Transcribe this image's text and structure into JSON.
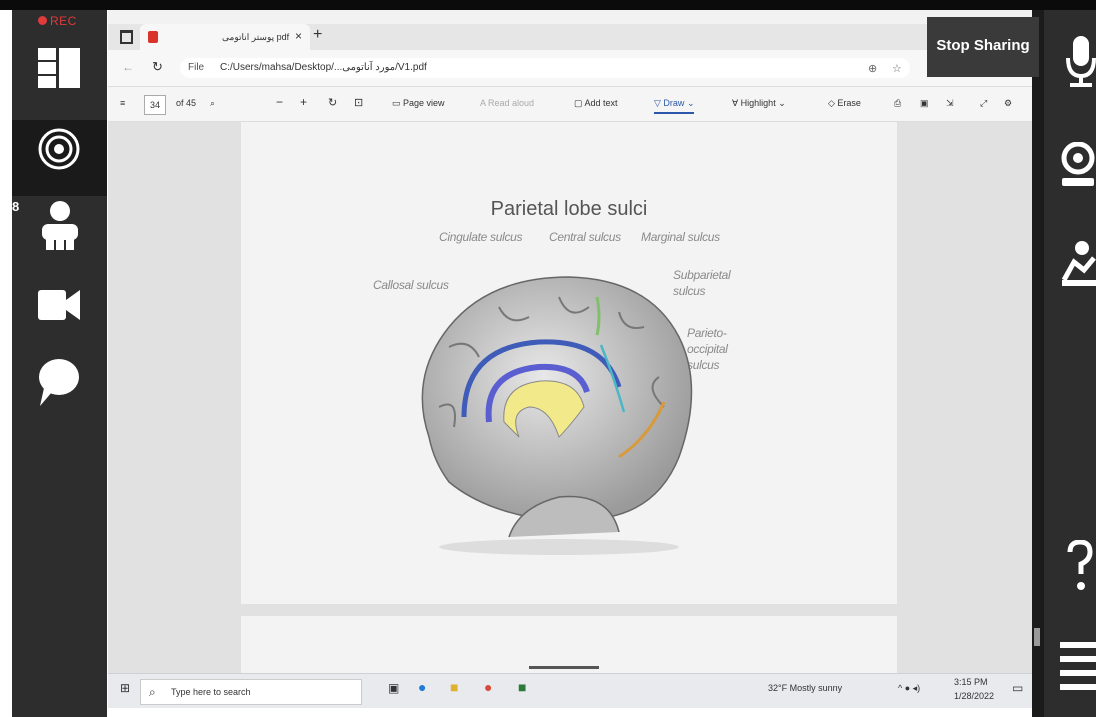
{
  "recorder": {
    "rec_label": "REC",
    "participant_count": "8"
  },
  "share": {
    "stop_label": "Stop Sharing"
  },
  "browser": {
    "tab_title": "پوستر اناتومی pdf",
    "tab_close": "×",
    "new_tab": "+",
    "file_label": "File",
    "url": "C:/Users/mahsa/Desktop/...مورد آناتومی/V1.pdf"
  },
  "pdf_toolbar": {
    "page_number": "34",
    "page_total": "of 45",
    "page_view": "Page view",
    "read_aloud": "Read aloud",
    "add_text": "Add text",
    "draw": "Draw",
    "highlight": "Highlight",
    "erase": "Erase"
  },
  "page": {
    "title": "Parietal lobe sulci",
    "labels": {
      "cingulate": "Cingulate sulcus",
      "central": "Central sulcus",
      "marginal": "Marginal sulcus",
      "callosal": "Callosal sulcus",
      "subparietal_1": "Subparietal",
      "subparietal_2": "sulcus",
      "parieto_1": "Parieto-",
      "parieto_2": "occipital",
      "parieto_3": "sulcus"
    },
    "colors": {
      "cingulate": "#3e5cb8",
      "callosal": "#5b5ed0",
      "corpus": "#f2e98a",
      "central": "#4ab7c6",
      "marginal": "#7fc06a",
      "parieto": "#d89a3a"
    }
  },
  "taskbar": {
    "search_placeholder": "Type here to search",
    "weather": "32°F  Mostly sunny",
    "time": "3:15 PM",
    "date": "1/28/2022"
  }
}
